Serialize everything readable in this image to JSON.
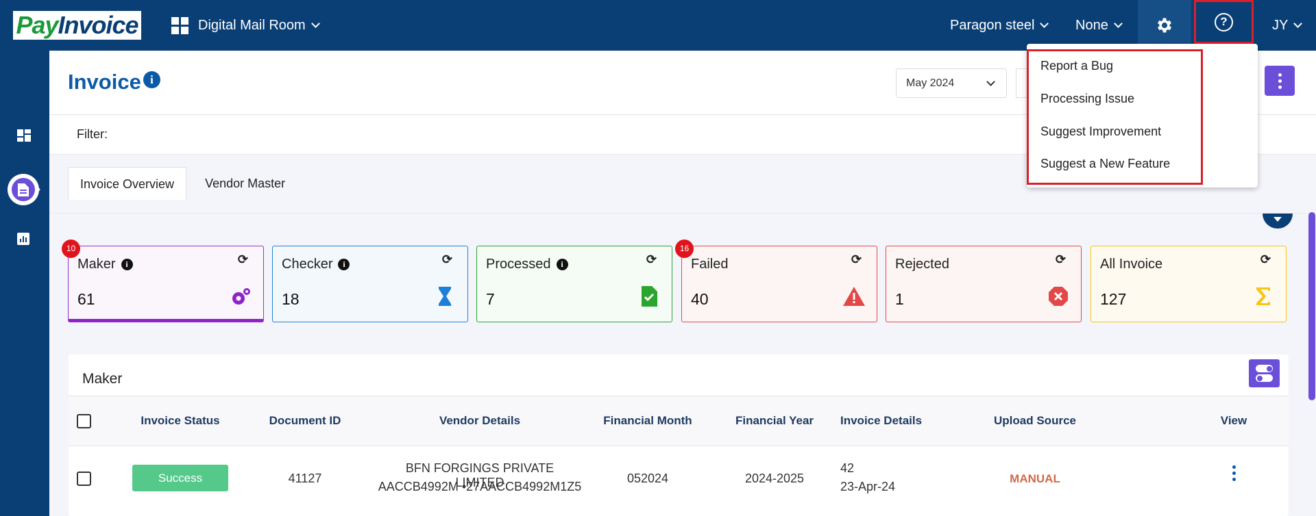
{
  "app": {
    "logo_part1": "Pay",
    "logo_part2": "Invoice"
  },
  "topbar": {
    "module": "Digital Mail Room",
    "company": "Paragon steel",
    "entity": "None",
    "user_initials": "JY"
  },
  "page": {
    "title": "Invoice",
    "month": "May 2024",
    "filter_label": "Filter:"
  },
  "tabs": [
    "Invoice Overview",
    "Vendor Master"
  ],
  "cards": [
    {
      "label": "Maker",
      "value": "61",
      "badge": "10",
      "color": "#8e24c7"
    },
    {
      "label": "Checker",
      "value": "18",
      "color": "#1e7fd8"
    },
    {
      "label": "Processed",
      "value": "7",
      "color": "#2aa52e"
    },
    {
      "label": "Failed",
      "value": "40",
      "badge": "16",
      "color": "#e34848"
    },
    {
      "label": "Rejected",
      "value": "1",
      "color": "#e34848"
    },
    {
      "label": "All Invoice",
      "value": "127",
      "color": "#f5c518"
    }
  ],
  "panel": {
    "title": "Maker"
  },
  "table": {
    "headers": [
      "Invoice Status",
      "Document ID",
      "Vendor Details",
      "Financial Month",
      "Financial Year",
      "Invoice Details",
      "Upload Source",
      "View"
    ],
    "rows": [
      {
        "status": "Success",
        "document_id": "41127",
        "vendor_name": "BFN FORGINGS PRIVATE LIMITED",
        "vendor_ids": "AACCB4992M  •27AACCB4992M1Z5",
        "financial_month": "052024",
        "financial_year": "2024-2025",
        "invoice_no": "42",
        "invoice_date": "23-Apr-24",
        "upload_source": "MANUAL"
      }
    ]
  },
  "help_menu": [
    "Report a Bug",
    "Processing Issue",
    "Suggest Improvement",
    "Suggest a New Feature"
  ]
}
